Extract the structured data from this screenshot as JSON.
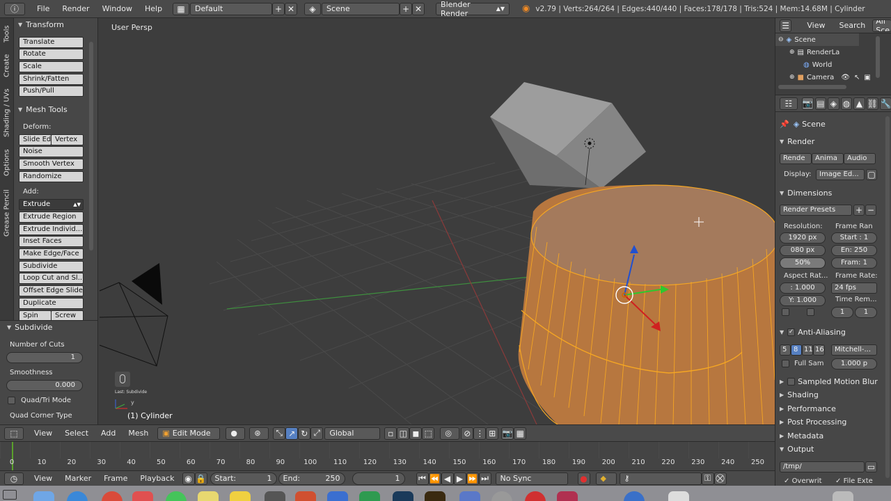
{
  "topbar": {
    "menus": [
      "File",
      "Render",
      "Window",
      "Help"
    ],
    "layout": "Default",
    "scene": "Scene",
    "engine": "Blender Render",
    "stats": "v2.79 | Verts:264/264 | Edges:440/440 | Faces:178/178 | Tris:524 | Mem:14.68M | Cylinder"
  },
  "tabs": [
    "Tools",
    "Create",
    "Shading / UVs",
    "Options",
    "Grease Pencil"
  ],
  "toolshelf": {
    "transform_title": "Transform",
    "transform": [
      "Translate",
      "Rotate",
      "Scale",
      "Shrink/Fatten",
      "Push/Pull"
    ],
    "mesh_tools_title": "Mesh Tools",
    "deform_label": "Deform:",
    "slide_edge": "Slide Ed",
    "vertex": "Vertex",
    "deform_tools": [
      "Noise",
      "Smooth Vertex",
      "Randomize"
    ],
    "add_label": "Add:",
    "extrude": "Extrude",
    "add_tools": [
      "Extrude Region",
      "Extrude Individ...",
      "Inset Faces",
      "Make Edge/Face",
      "Subdivide",
      "Loop Cut and Sl...",
      "Offset Edge Slide",
      "Duplicate"
    ],
    "spin": "Spin",
    "screw": "Screw"
  },
  "operator": {
    "title": "Subdivide",
    "cuts_label": "Number of Cuts",
    "cuts_value": "1",
    "smooth_label": "Smoothness",
    "smooth_value": "0.000",
    "quadtri_label": "Quad/Tri Mode",
    "corner_label": "Quad Corner Type"
  },
  "viewport": {
    "view_name": "User Persp",
    "object_label": "(1) Cylinder",
    "last_op": "Last: Subdivide",
    "axis_y": "y"
  },
  "outliner": {
    "menu": [
      "View",
      "Search"
    ],
    "filter": "All Sce",
    "items": [
      "Scene",
      "RenderLa",
      "World",
      "Camera"
    ]
  },
  "properties": {
    "context": "Scene",
    "render_title": "Render",
    "render_btns": [
      "Rende",
      "Anima",
      "Audio"
    ],
    "display_label": "Display:",
    "display_value": "Image Ed...",
    "dimensions_title": "Dimensions",
    "presets": "Render Presets",
    "resolution_label": "Resolution:",
    "frame_range_label": "Frame Ran",
    "res_x": "1920 px",
    "res_y": "080 px",
    "res_pct": "50%",
    "start": "Start : 1",
    "end": "En: 250",
    "step": "Fram: 1",
    "aspect_label": "Aspect Rat...",
    "framerate_label": "Frame Rate:",
    "aspect_x": ": 1.000",
    "aspect_y": "Y: 1.000",
    "fps": "24 fps",
    "time_label": "Time Rem...",
    "time_a": "1",
    "time_b": "1",
    "aa_title": "Anti-Aliasing",
    "aa_samples": [
      "5",
      "8",
      "11",
      "16"
    ],
    "aa_filter": "Mitchell-...",
    "fullsam": "Full Sam",
    "aa_size": "1.000 p",
    "collapsed": [
      "Sampled Motion Blur",
      "Shading",
      "Performance",
      "Post Processing",
      "Metadata"
    ],
    "output_title": "Output",
    "output_path": "/tmp/",
    "overwrite": "Overwrit",
    "file_ext": "File Exte"
  },
  "vheader": {
    "menus": [
      "View",
      "Select",
      "Add",
      "Mesh"
    ],
    "mode": "Edit Mode",
    "orientation": "Global"
  },
  "timeline": {
    "ticks": [
      "0",
      "10",
      "20",
      "30",
      "40",
      "50",
      "60",
      "70",
      "80",
      "90",
      "100",
      "110",
      "120",
      "130",
      "140",
      "150",
      "160",
      "170",
      "180",
      "190",
      "200",
      "210",
      "220",
      "230",
      "240",
      "250"
    ],
    "menus": [
      "View",
      "Marker",
      "Frame",
      "Playback"
    ],
    "start_label": "Start:",
    "start_value": "1",
    "end_label": "End:",
    "end_value": "250",
    "current": "1",
    "sync": "No Sync"
  },
  "colors": {
    "accent": "#5680c2",
    "selection": "#f5a623",
    "bg": "#3d3d3d"
  }
}
